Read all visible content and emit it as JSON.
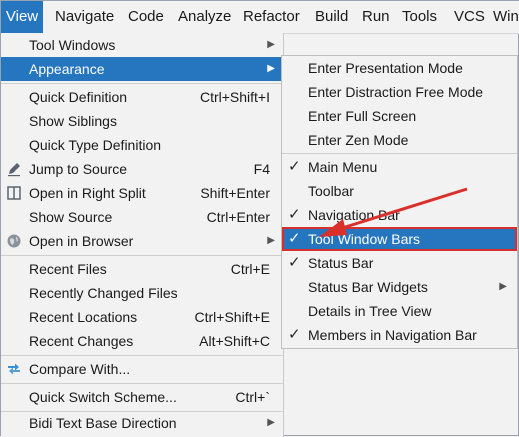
{
  "menubar": {
    "items": [
      {
        "label": "View",
        "active": true
      },
      {
        "label": "Navigate"
      },
      {
        "label": "Code"
      },
      {
        "label": "Analyze"
      },
      {
        "label": "Refactor"
      },
      {
        "label": "Build"
      },
      {
        "label": "Run"
      },
      {
        "label": "Tools"
      },
      {
        "label": "VCS"
      },
      {
        "label": "Win"
      }
    ]
  },
  "view_menu": {
    "items": [
      {
        "label": "Tool Windows",
        "submenu": true
      },
      {
        "label": "Appearance",
        "submenu": true,
        "selected": true
      },
      {
        "label": "Quick Definition",
        "shortcut": "Ctrl+Shift+I"
      },
      {
        "label": "Show Siblings"
      },
      {
        "label": "Quick Type Definition"
      },
      {
        "label": "Jump to Source",
        "shortcut": "F4",
        "icon": "pencil-icon"
      },
      {
        "label": "Open in Right Split",
        "shortcut": "Shift+Enter",
        "icon": "split-window-icon"
      },
      {
        "label": "Show Source",
        "shortcut": "Ctrl+Enter"
      },
      {
        "label": "Open in Browser",
        "submenu": true,
        "icon": "globe-icon"
      },
      {
        "label": "Recent Files",
        "shortcut": "Ctrl+E"
      },
      {
        "label": "Recently Changed Files"
      },
      {
        "label": "Recent Locations",
        "shortcut": "Ctrl+Shift+E"
      },
      {
        "label": "Recent Changes",
        "shortcut": "Alt+Shift+C"
      },
      {
        "label": "Compare With...",
        "icon": "compare-arrows-icon"
      },
      {
        "label": "Quick Switch Scheme...",
        "shortcut": "Ctrl+`"
      },
      {
        "label": "Bidi Text Base Direction",
        "submenu": true
      }
    ]
  },
  "appearance_submenu": {
    "items": [
      {
        "label": "Enter Presentation Mode"
      },
      {
        "label": "Enter Distraction Free Mode"
      },
      {
        "label": "Enter Full Screen"
      },
      {
        "label": "Enter Zen Mode"
      },
      {
        "label": "Main Menu",
        "checked": true
      },
      {
        "label": "Toolbar"
      },
      {
        "label": "Navigation Bar",
        "checked": true
      },
      {
        "label": "Tool Window Bars",
        "checked": true,
        "selected": true
      },
      {
        "label": "Status Bar",
        "checked": true
      },
      {
        "label": "Status Bar Widgets",
        "submenu": true
      },
      {
        "label": "Details in Tree View"
      },
      {
        "label": "Members in Navigation Bar",
        "checked": true
      }
    ]
  },
  "glyphs": {
    "check": "✓",
    "submenu_arrow": "▶"
  },
  "colors": {
    "selection": "#2675bf",
    "annotation_red": "#d9302c"
  }
}
